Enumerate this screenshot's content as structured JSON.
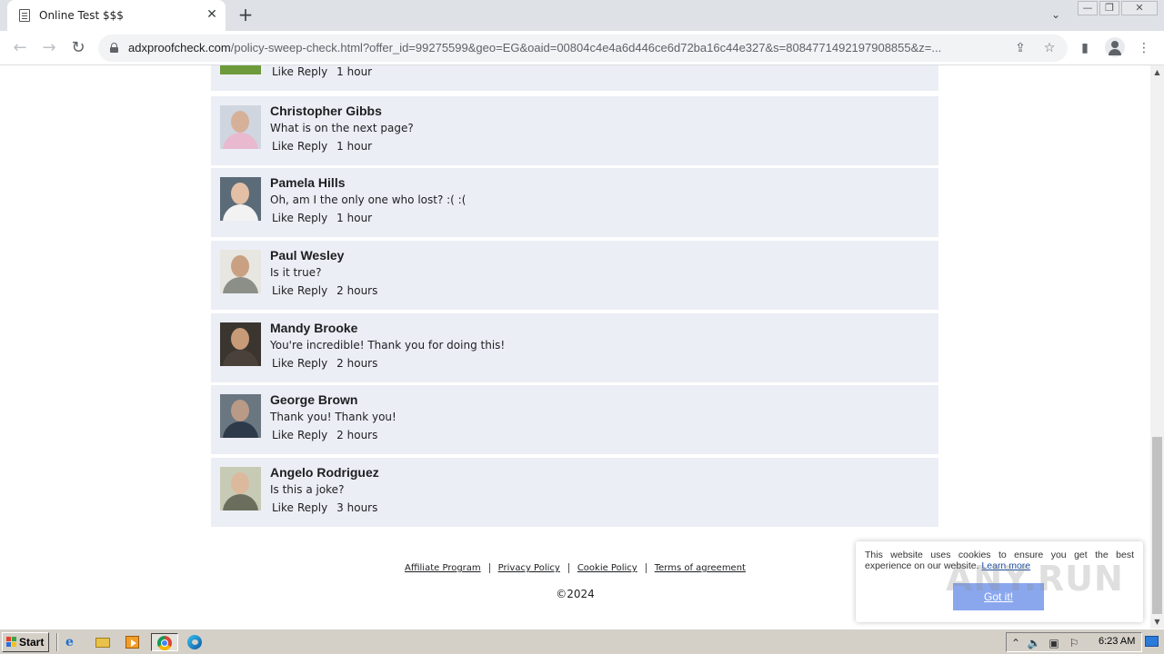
{
  "browser": {
    "tab": {
      "title": "Online Test $$$",
      "favicon": "document-icon",
      "close_glyph": "✕"
    },
    "new_tab_glyph": "+",
    "tab_dropdown_glyph": "⌄",
    "window_controls": {
      "minimize": "—",
      "restore": "❐",
      "close": "✕"
    },
    "nav": {
      "back": "←",
      "forward": "→",
      "reload": "↻"
    },
    "url": {
      "host": "adxproofcheck.com",
      "rest": "/policy-sweep-check.html?offer_id=99275599&geo=EG&oaid=00804c4e4a6d446ce6d72ba16c44e327&s=8084771492197908855&z=..."
    },
    "omnibox_icons": {
      "share": "⇪",
      "bookmark": "☆"
    },
    "toolbar_icons": {
      "sidepanel": "▮",
      "menu": "⋮"
    }
  },
  "page": {
    "partial_comment": {
      "like": "Like",
      "reply": "Reply",
      "time": "1 hour"
    },
    "comments": [
      {
        "name": "Christopher Gibbs",
        "text": "What is on the next page?",
        "like": "Like",
        "reply": "Reply",
        "time": "1 hour"
      },
      {
        "name": "Pamela Hills",
        "text": "Oh, am I the only one who lost? :( :(",
        "like": "Like",
        "reply": "Reply",
        "time": "1 hour"
      },
      {
        "name": "Paul Wesley",
        "text": "Is it true?",
        "like": "Like",
        "reply": "Reply",
        "time": "2 hours"
      },
      {
        "name": "Mandy Brooke",
        "text": "You're incredible! Thank you for doing this!",
        "like": "Like",
        "reply": "Reply",
        "time": "2 hours"
      },
      {
        "name": "George Brown",
        "text": "Thank you! Thank you!",
        "like": "Like",
        "reply": "Reply",
        "time": "2 hours"
      },
      {
        "name": "Angelo Rodriguez",
        "text": "Is this a joke?",
        "like": "Like",
        "reply": "Reply",
        "time": "3 hours"
      }
    ],
    "footer_links": [
      "Affiliate Program",
      "Privacy Policy",
      "Cookie Policy",
      "Terms of agreement"
    ],
    "copyright": "©2024"
  },
  "cookie_banner": {
    "text": "This website uses cookies to ensure you get the best experience on our website.",
    "learn_more": "Learn more",
    "button": "Got it!"
  },
  "watermark": "ANY.RUN",
  "taskbar": {
    "start_label": "Start",
    "apps": [
      "internet-explorer-icon",
      "folder-icon",
      "media-player-icon",
      "chrome-icon",
      "edge-icon"
    ],
    "tray_icons": {
      "expand": "⌃",
      "volume": "🔈",
      "network": "▣",
      "flag": "⚐"
    },
    "clock": "6:23 AM"
  },
  "colors": {
    "comment_bg": "#eceef5",
    "tabbar_bg": "#dee1e6",
    "taskbar_bg": "#d4d0c8",
    "cookie_button": "#8aa7ee",
    "link_blue": "#1a4fa0"
  }
}
